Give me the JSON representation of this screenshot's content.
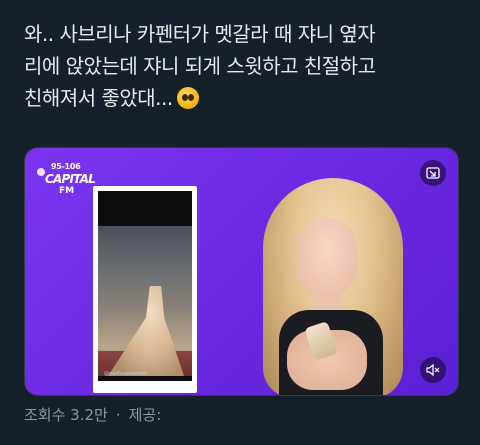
{
  "tweet": {
    "lines": [
      "와.. 사브리나 카펜터가 멧갈라 때 쟈니 옆자",
      "리에 앉았는데 쟈니 되게 스윗하고 친절하고",
      "친해져서 좋았대..."
    ],
    "emoji": "pleading-face-emoji"
  },
  "media": {
    "logo": {
      "frequency": "95-106",
      "brand": "CAPITAL",
      "suffix": "FM"
    },
    "phone_watermark": "@yunhospromise",
    "buttons": {
      "pip_icon": "pip-icon",
      "mute_icon": "mute-icon"
    },
    "colors": {
      "background": "#6a28e0"
    }
  },
  "footer": {
    "views": "조회수 3.2만",
    "separator": "·",
    "source_label": "제공:"
  },
  "colors": {
    "page_background": "#15202b",
    "text": "#e7e9ea",
    "muted": "#8b98a5"
  }
}
